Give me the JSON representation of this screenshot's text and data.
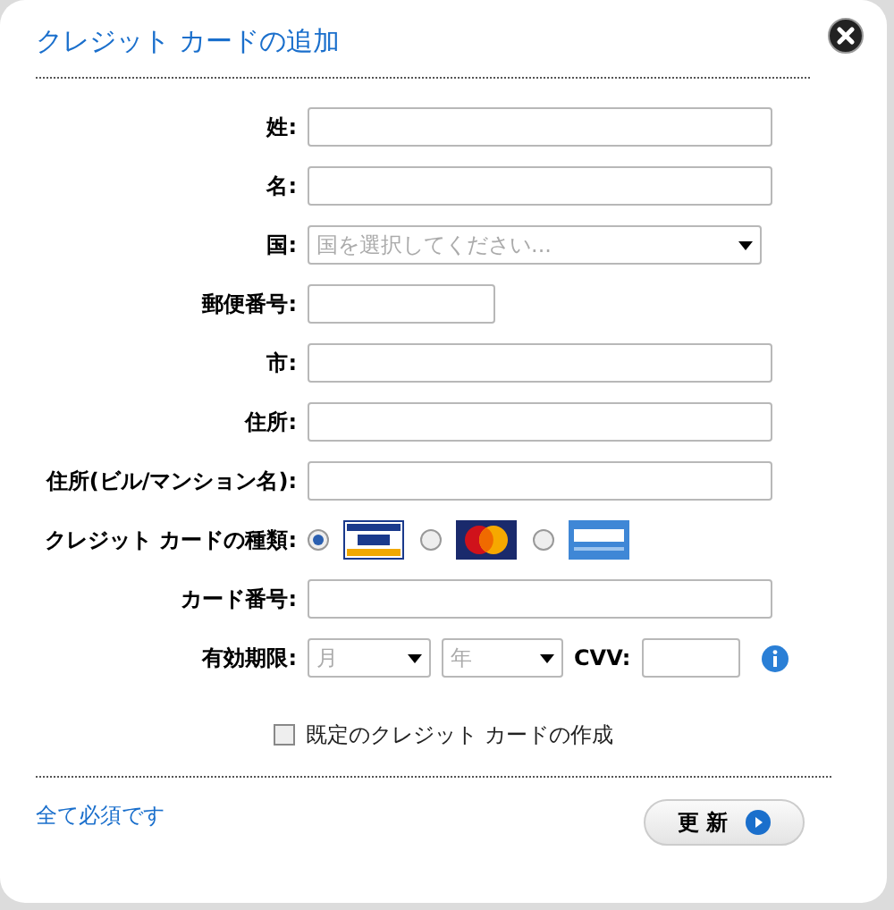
{
  "dialog": {
    "title": "クレジット カードの追加"
  },
  "fields": [
    {
      "kind": "text",
      "label": "姓:"
    },
    {
      "kind": "text",
      "label": "名:"
    },
    {
      "kind": "select",
      "label": "国:",
      "placeholder": "国を選択してください..."
    },
    {
      "kind": "short",
      "label": "郵便番号:"
    },
    {
      "kind": "text",
      "label": "市:"
    },
    {
      "kind": "text",
      "label": "住所:"
    },
    {
      "kind": "text",
      "label": "住所(ビル/マンション名):"
    },
    {
      "kind": "cardtype",
      "label": "クレジット カードの種類:",
      "options": [
        {
          "kind": "visa",
          "selected": true
        },
        {
          "kind": "mastercard",
          "selected": false
        },
        {
          "kind": "amex",
          "selected": false
        }
      ]
    },
    {
      "kind": "text",
      "label": "カード番号:"
    },
    {
      "kind": "expiry",
      "label": "有効期限:",
      "month": "月",
      "year": "年",
      "cvv_label": "CVV:"
    }
  ],
  "default_card": {
    "label": "既定のクレジット カードの作成",
    "checked": false
  },
  "footer": {
    "note": "全て必須です",
    "button": "更 新"
  }
}
